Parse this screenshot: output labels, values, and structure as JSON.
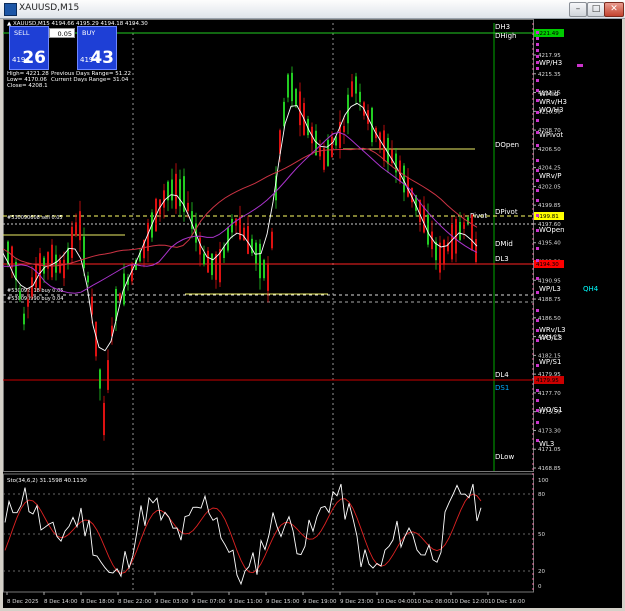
{
  "window": {
    "title": "XAUUSD,M15",
    "min_glyph": "–",
    "max_glyph": "□",
    "close_glyph": "✕"
  },
  "header": {
    "text": "▲ XAUUSD,M15  4194.66 4195.29 4194.18 4194.30"
  },
  "trade_panel": {
    "sell_label": "SELL",
    "buy_label": "BUY",
    "lot": "0.05",
    "sell_small": "4194",
    "sell_big": "26",
    "buy_small": "4194",
    "buy_big": "43"
  },
  "info": {
    "high": "High= 4221.28",
    "low": "Low= 4170.06",
    "close": "Close= 4208.1",
    "prev_range": "Previous Days Range= 51.22",
    "curr_range": "Current Days Range= 31.04"
  },
  "price_axis": {
    "ticks": [
      "4217.95",
      "4215.35",
      "4213.15",
      "4210.90",
      "4208.70",
      "4206.50",
      "4204.25",
      "4202.05",
      "4199.85",
      "4197.60",
      "4195.40",
      "4193.20",
      "4190.95",
      "4188.75",
      "4186.50",
      "4184.25",
      "4182.15",
      "4179.95",
      "4177.70",
      "4175.50",
      "4173.30",
      "4171.05",
      "4168.85"
    ],
    "tags": [
      {
        "text": "4221.49",
        "color": "#00cc00"
      },
      {
        "text": "4199.81",
        "color": "#ffff00"
      },
      {
        "text": "4194.30",
        "color": "#ff0000"
      },
      {
        "text": "4179.95",
        "color": "#cc0000"
      }
    ]
  },
  "levels": [
    {
      "text": "DH3",
      "color": "#ffffff"
    },
    {
      "text": "DHigh",
      "color": "#ffffff"
    },
    {
      "text": "WP/H3",
      "color": "#ffffff"
    },
    {
      "text": "WMid",
      "color": "#ffffff"
    },
    {
      "text": "WRv/H3",
      "color": "#ffffff"
    },
    {
      "text": "WO/H3",
      "color": "#ffffff"
    },
    {
      "text": "WPivot",
      "color": "#ffffff"
    },
    {
      "text": "DOpen",
      "color": "#ffffff"
    },
    {
      "text": "WRv/P",
      "color": "#ffffff"
    },
    {
      "text": "DPivot",
      "color": "#ffffff"
    },
    {
      "text": "Pivot",
      "color": "#ffffff"
    },
    {
      "text": "WOpen",
      "color": "#ffffff"
    },
    {
      "text": "DMid",
      "color": "#ffffff"
    },
    {
      "text": "DL3",
      "color": "#ffffff"
    },
    {
      "text": "WP/L3",
      "color": "#ffffff"
    },
    {
      "text": "QH4",
      "color": "#00ffff"
    },
    {
      "text": "WRv/L3",
      "color": "#ffffff"
    },
    {
      "text": "WO/L3",
      "color": "#ffffff"
    },
    {
      "text": "WP/S1",
      "color": "#ffffff"
    },
    {
      "text": "DL4",
      "color": "#ffffff"
    },
    {
      "text": "DS1",
      "color": "#00aaff"
    },
    {
      "text": "WO/S1",
      "color": "#ffffff"
    },
    {
      "text": "WL3",
      "color": "#ffffff"
    },
    {
      "text": "DLow",
      "color": "#ffffff"
    }
  ],
  "orders": [
    {
      "text": "#530090608 sell 0.05"
    },
    {
      "text": "#530092118 buy 0.05"
    },
    {
      "text": "#530090990 buy 0.04"
    }
  ],
  "oscillator": {
    "label": "Sto(34,6,2) 31.1598 40.1130",
    "ticks": [
      "100",
      "80",
      "50",
      "20",
      "0"
    ]
  },
  "time_axis": [
    "8 Dec 2025",
    "8 Dec 14:00",
    "8 Dec 18:00",
    "8 Dec 22:00",
    "9 Dec 03:00",
    "9 Dec 07:00",
    "9 Dec 11:00",
    "9 Dec 15:00",
    "9 Dec 19:00",
    "9 Dec 23:00",
    "10 Dec 04:00",
    "10 Dec 08:00",
    "10 Dec 12:00",
    "10 Dec 16:00"
  ],
  "colors": {
    "bull": "#22cc22",
    "bear": "#dd1111",
    "ma_fast": "#ffffff",
    "ma_slow": "#cc3344",
    "ma_mid": "#aa33cc"
  }
}
